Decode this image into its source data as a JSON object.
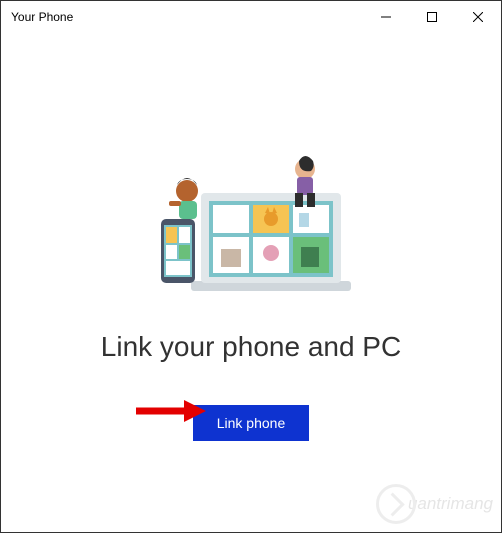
{
  "window": {
    "title": "Your Phone"
  },
  "main": {
    "heading": "Link your phone and PC",
    "button_label": "Link phone"
  },
  "watermark": {
    "text": "uantrimang"
  }
}
